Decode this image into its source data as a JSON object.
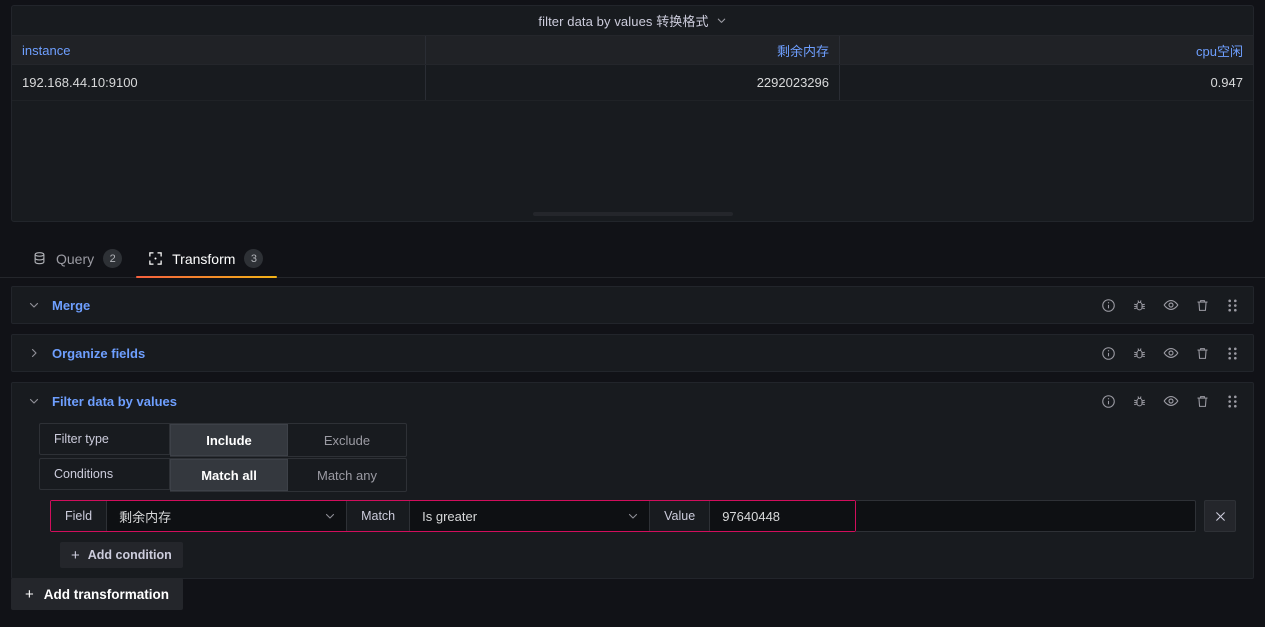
{
  "panel": {
    "title": "filter data by values 转换格式",
    "title_chevron_icon": "chevron-down-icon",
    "table": {
      "headers": [
        "instance",
        "剩余内存",
        "cpu空闲"
      ],
      "rows": [
        [
          "192.168.44.10:9100",
          "2292023296",
          "0.947"
        ]
      ]
    }
  },
  "tabs": [
    {
      "label": "Query",
      "badge": "2",
      "icon": "database-icon",
      "active": false
    },
    {
      "label": "Transform",
      "badge": "3",
      "icon": "transform-icon",
      "active": true
    }
  ],
  "transformations": [
    {
      "name": "Merge",
      "expanded": true,
      "chevron_icon": "chevron-down-icon"
    },
    {
      "name": "Organize fields",
      "expanded": false,
      "chevron_icon": "chevron-right-icon"
    },
    {
      "name": "Filter data by values",
      "expanded": true,
      "chevron_icon": "chevron-down-icon"
    }
  ],
  "row_actions": [
    "info-icon",
    "bug-icon",
    "eye-icon",
    "trash-icon",
    "drag-handle-icon"
  ],
  "filter_editor": {
    "filter_type": {
      "label": "Filter type",
      "options": [
        "Include",
        "Exclude"
      ],
      "selected": "Include"
    },
    "conditions_mode": {
      "label": "Conditions",
      "options": [
        "Match all",
        "Match any"
      ],
      "selected": "Match all"
    },
    "condition": {
      "field_label": "Field",
      "field_value": "剩余内存",
      "match_label": "Match",
      "match_value": "Is greater",
      "value_label": "Value",
      "value_value": "97640448",
      "remove_icon": "close-icon"
    },
    "add_condition_label": "Add condition"
  },
  "add_transformation_label": "Add transformation",
  "colors": {
    "page_bg": "#111217",
    "panel_bg": "#181b1f",
    "accent_orange": "#f55f3e",
    "link_blue": "#6e9fff",
    "error_red": "#d10e5c"
  }
}
